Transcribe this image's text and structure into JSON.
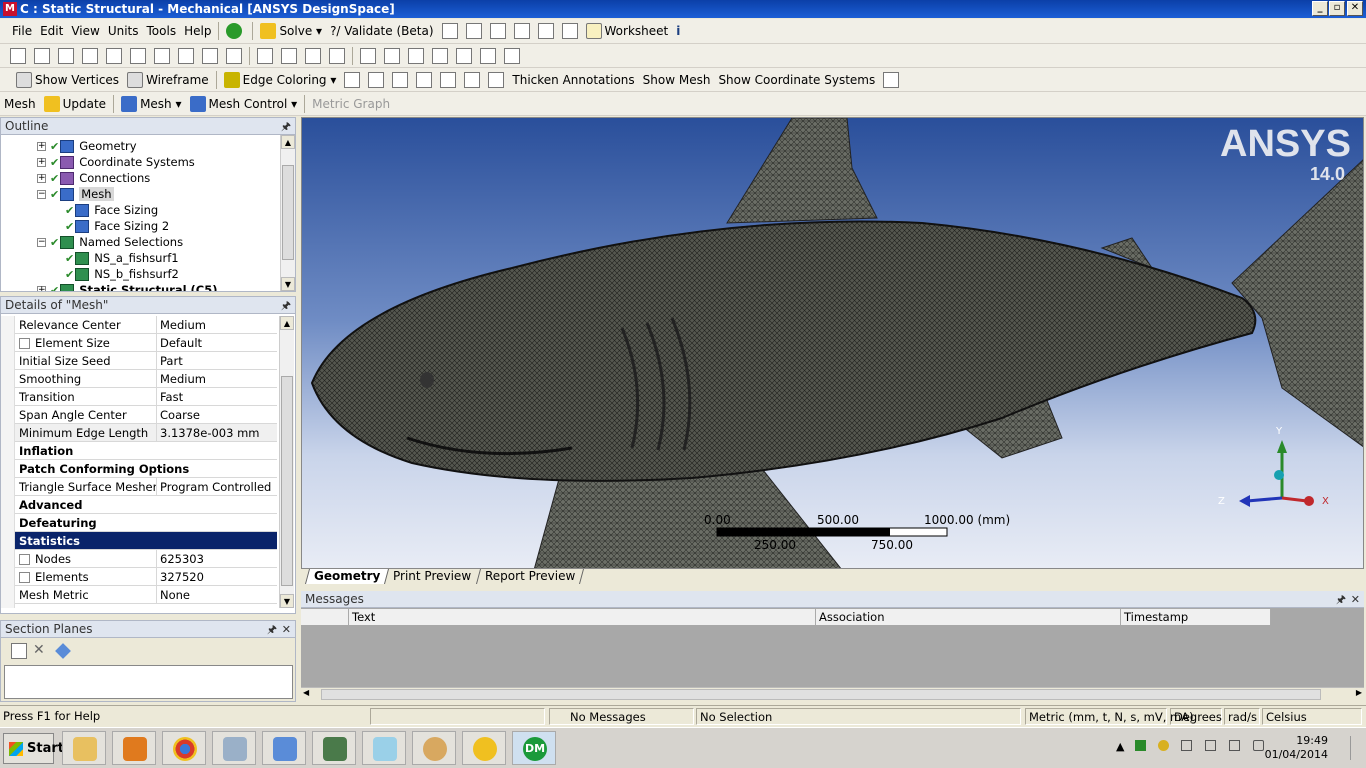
{
  "window": {
    "title": "C : Static Structural - Mechanical [ANSYS DesignSpace]",
    "logo_letter": "M",
    "min": "_",
    "max": "▫",
    "close": "✕"
  },
  "menu": {
    "items": [
      "File",
      "Edit",
      "View",
      "Units",
      "Tools",
      "Help"
    ],
    "solve": "Solve",
    "validate": "?/ Validate (Beta)",
    "worksheet": "Worksheet"
  },
  "toolbar3": {
    "show_vertices": "Show Vertices",
    "wireframe": "Wireframe",
    "edge_coloring": "Edge Coloring",
    "thicken": "Thicken Annotations",
    "show_mesh": "Show Mesh",
    "show_coord": "Show Coordinate Systems"
  },
  "toolbar4": {
    "mesh": "Mesh",
    "update": "Update",
    "mesh_dd": "Mesh",
    "mesh_control": "Mesh Control",
    "metric_graph": "Metric Graph"
  },
  "outline": {
    "title": "Outline",
    "pin": "🖈",
    "nodes": [
      {
        "label": "Geometry",
        "level": 1,
        "exp": "+"
      },
      {
        "label": "Coordinate Systems",
        "level": 1,
        "exp": "+"
      },
      {
        "label": "Connections",
        "level": 1,
        "exp": "+"
      },
      {
        "label": "Mesh",
        "level": 1,
        "exp": "−"
      },
      {
        "label": "Face Sizing",
        "level": 2,
        "exp": ""
      },
      {
        "label": "Face Sizing 2",
        "level": 2,
        "exp": ""
      },
      {
        "label": "Named Selections",
        "level": 1,
        "exp": "−"
      },
      {
        "label": "NS_a_fishsurf1",
        "level": 2,
        "exp": ""
      },
      {
        "label": "NS_b_fishsurf2",
        "level": 2,
        "exp": ""
      },
      {
        "label": "Static Structural (C5)",
        "level": 1,
        "exp": "+"
      }
    ]
  },
  "details": {
    "title": "Details of \"Mesh\"",
    "rows": [
      {
        "k": "Relevance Center",
        "v": "Medium",
        "type": "prop"
      },
      {
        "k": "Element Size",
        "v": "Default",
        "type": "check"
      },
      {
        "k": "Initial Size Seed",
        "v": "Part",
        "type": "prop"
      },
      {
        "k": "Smoothing",
        "v": "Medium",
        "type": "prop"
      },
      {
        "k": "Transition",
        "v": "Fast",
        "type": "prop"
      },
      {
        "k": "Span Angle Center",
        "v": "Coarse",
        "type": "prop"
      },
      {
        "k": "Minimum Edge Length",
        "v": "3.1378e-003 mm",
        "type": "ro"
      },
      {
        "k": "Inflation",
        "v": "",
        "type": "grp",
        "exp": "+"
      },
      {
        "k": "Patch Conforming Options",
        "v": "",
        "type": "grp",
        "exp": "−"
      },
      {
        "k": "Triangle Surface Mesher",
        "v": "Program Controlled",
        "type": "prop"
      },
      {
        "k": "Advanced",
        "v": "",
        "type": "grp",
        "exp": "+"
      },
      {
        "k": "Defeaturing",
        "v": "",
        "type": "grp",
        "exp": "+"
      },
      {
        "k": "Statistics",
        "v": "",
        "type": "sel",
        "exp": "−"
      },
      {
        "k": "Nodes",
        "v": "625303",
        "type": "check"
      },
      {
        "k": "Elements",
        "v": "327520",
        "type": "check"
      },
      {
        "k": "Mesh Metric",
        "v": "None",
        "type": "prop"
      }
    ]
  },
  "section_planes": {
    "title": "Section Planes",
    "pin": "🖈",
    "close": "✕"
  },
  "viewport": {
    "brand": "ANSYS",
    "version": "14.0",
    "scale": {
      "l0": "0.00",
      "l1": "500.00",
      "l2": "1000.00 (mm)",
      "l3": "250.00",
      "l4": "750.00"
    },
    "axes": {
      "x": "X",
      "y": "Y",
      "z": "Z"
    },
    "colors": {
      "mesh": "#3d3d3d",
      "axis_x": "#c0282c",
      "axis_y": "#2a8a2a",
      "axis_z": "#2235b8"
    }
  },
  "tabs": [
    "Geometry",
    "Print Preview",
    "Report Preview"
  ],
  "messages": {
    "title": "Messages",
    "cols": [
      "Text",
      "Association",
      "Timestamp"
    ],
    "pin": "🖈",
    "close": "✕"
  },
  "status": {
    "help": "Press F1 for Help",
    "messages": "No Messages",
    "selection": "No Selection",
    "units": "Metric (mm, t, N, s, mV, mA)",
    "angle": "Degrees",
    "rate": "rad/s",
    "temp": "Celsius"
  },
  "taskbar": {
    "start": "Start",
    "time": "19:49",
    "date": "01/04/2014",
    "dm": "DM"
  }
}
